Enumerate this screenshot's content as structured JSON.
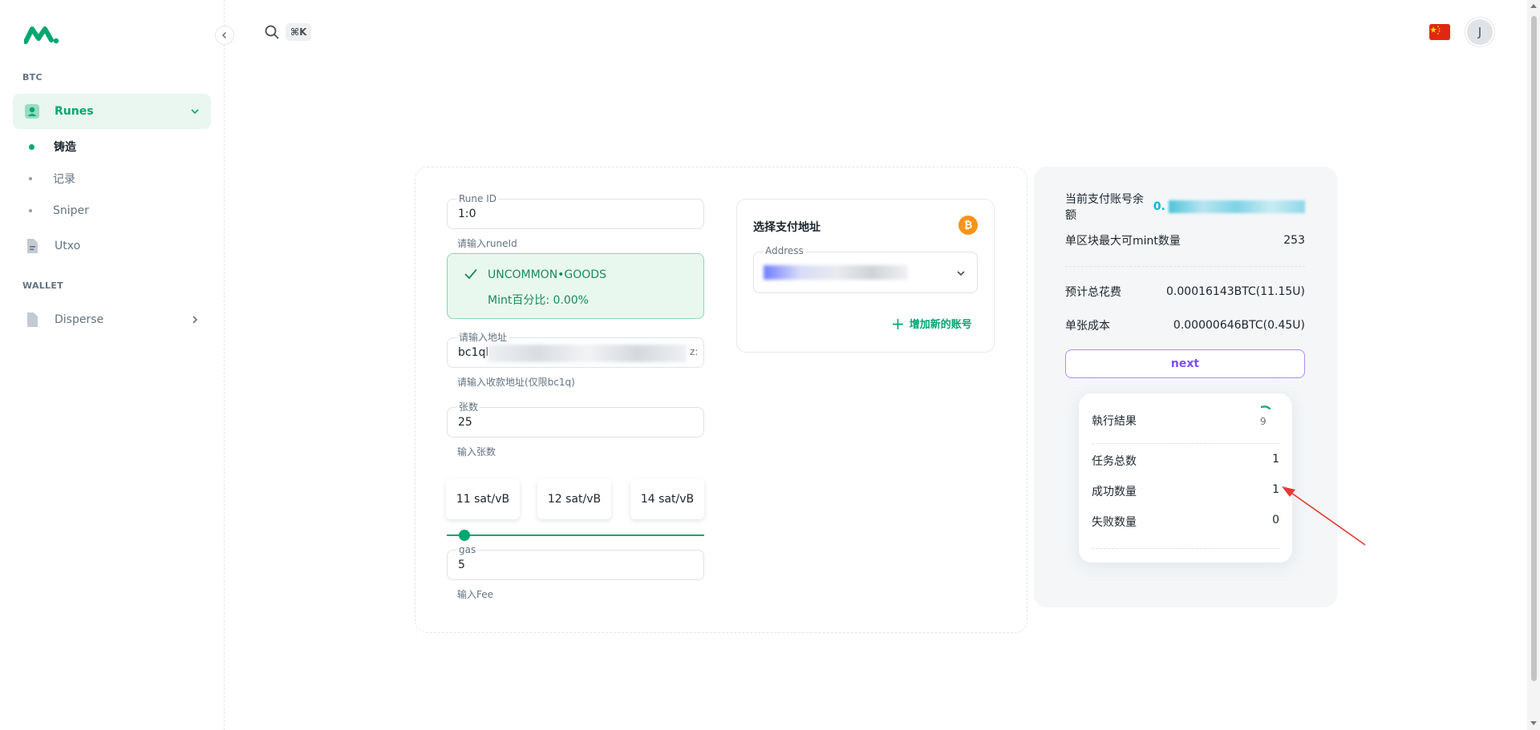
{
  "sidebar": {
    "section_btc": "BTC",
    "section_wallet": "WALLET",
    "items": [
      {
        "label": "Runes"
      },
      {
        "label": "Utxo"
      },
      {
        "label": "Disperse"
      }
    ],
    "sub_items": [
      {
        "label": "铸造"
      },
      {
        "label": "记录"
      },
      {
        "label": "Sniper"
      }
    ]
  },
  "header": {
    "shortcut": "⌘K",
    "avatar_initial": "J"
  },
  "form": {
    "rune_id": {
      "label": "Rune ID",
      "value": "1:0",
      "helper": "请输入runeId"
    },
    "rune_status": {
      "name": "UNCOMMON•GOODS",
      "mint_percent": "Mint百分比: 0.00%"
    },
    "address": {
      "label": "请输入地址",
      "value_start": "bc1ql",
      "value_end": "z:",
      "helper": "请输入收款地址(仅限bc1q)"
    },
    "quantity": {
      "label": "张数",
      "value": "25",
      "helper": "输入张数"
    },
    "fee_options": [
      "11 sat/vB",
      "12 sat/vB",
      "14 sat/vB"
    ],
    "gas": {
      "label": "gas",
      "value": "5",
      "helper": "输入Fee"
    }
  },
  "payment": {
    "title": "选择支付地址",
    "address_label": "Address",
    "add_account": "增加新的账号"
  },
  "summary": {
    "balance_label": "当前支付账号余额",
    "balance_prefix": "0.",
    "max_mint_label": "单区块最大可mint数量",
    "max_mint_value": "253",
    "total_fee_label": "预计总花费",
    "total_fee_value": "0.00016143BTC(11.15U)",
    "unit_cost_label": "单张成本",
    "unit_cost_value": "0.00000646BTC(0.45U)",
    "next_label": "next"
  },
  "result": {
    "title": "執行結果",
    "spinner_count": "9",
    "total_tasks_label": "任务总数",
    "total_tasks_value": "1",
    "success_label": "成功数量",
    "success_value": "1",
    "fail_label": "失败数量",
    "fail_value": "0"
  },
  "colors": {
    "primary": "#00a76f",
    "accent_purple": "#7c4dff",
    "bitcoin": "#f7931a",
    "annotation_arrow": "#e53935"
  }
}
